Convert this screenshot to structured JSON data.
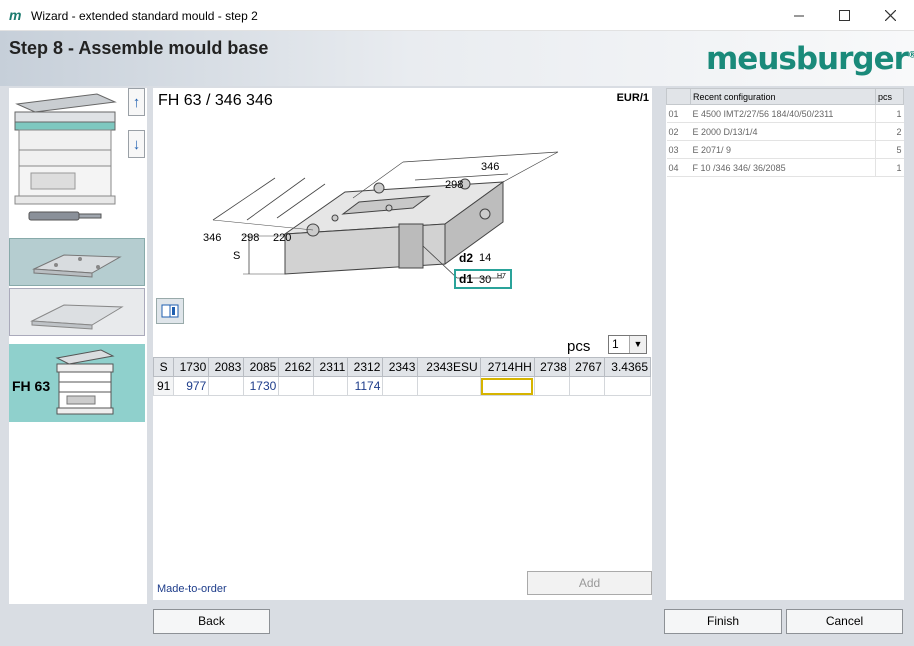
{
  "window": {
    "app_icon": "m",
    "title": "Wizard - extended standard mould - step 2"
  },
  "header": {
    "step_title": "Step 8 - Assemble mould base",
    "logo_text": "meusburger",
    "logo_mark": "®"
  },
  "left_panel": {
    "up_arrow": "↑",
    "down_arrow": "↓",
    "selected_label": "FH 63"
  },
  "part": {
    "title": "FH 63 / 346 346",
    "code": "EUR/1",
    "diagram": {
      "dim_346_top": "346",
      "dim_298_top": "298",
      "dim_346_left": "346",
      "dim_298_left": "298",
      "dim_220_left": "220",
      "dim_s": "S",
      "d2_label": "d2",
      "d2_value": "14",
      "d1_label": "d1",
      "d1_value": "30",
      "d1_tolerance": "H7"
    },
    "pcs_label": "pcs",
    "pcs_value": "1",
    "table": {
      "headers": [
        "S",
        "1730",
        "2083",
        "2085",
        "2162",
        "2311",
        "2312",
        "2343",
        "2343ESU",
        "2714HH",
        "2738",
        "2767",
        "3.4365"
      ],
      "rows": [
        [
          "91",
          "977",
          "",
          "1730",
          "",
          "",
          "1174",
          "",
          "",
          "",
          "",
          "",
          ""
        ]
      ]
    },
    "made_to_order": "Made-to-order",
    "add_label": "Add"
  },
  "recent": {
    "header_config": "Recent configuration",
    "header_pcs": "pcs",
    "rows": [
      {
        "n": "01",
        "config": "E 4500 IMT2/27/56 184/40/50/2311",
        "pcs": "1"
      },
      {
        "n": "02",
        "config": "E 2000 D/13/1/4",
        "pcs": "2"
      },
      {
        "n": "03",
        "config": "E 2071/  9",
        "pcs": "5"
      },
      {
        "n": "04",
        "config": "F 10 /346 346/ 36/2085",
        "pcs": "1"
      }
    ]
  },
  "buttons": {
    "back": "Back",
    "finish": "Finish",
    "cancel": "Cancel"
  }
}
